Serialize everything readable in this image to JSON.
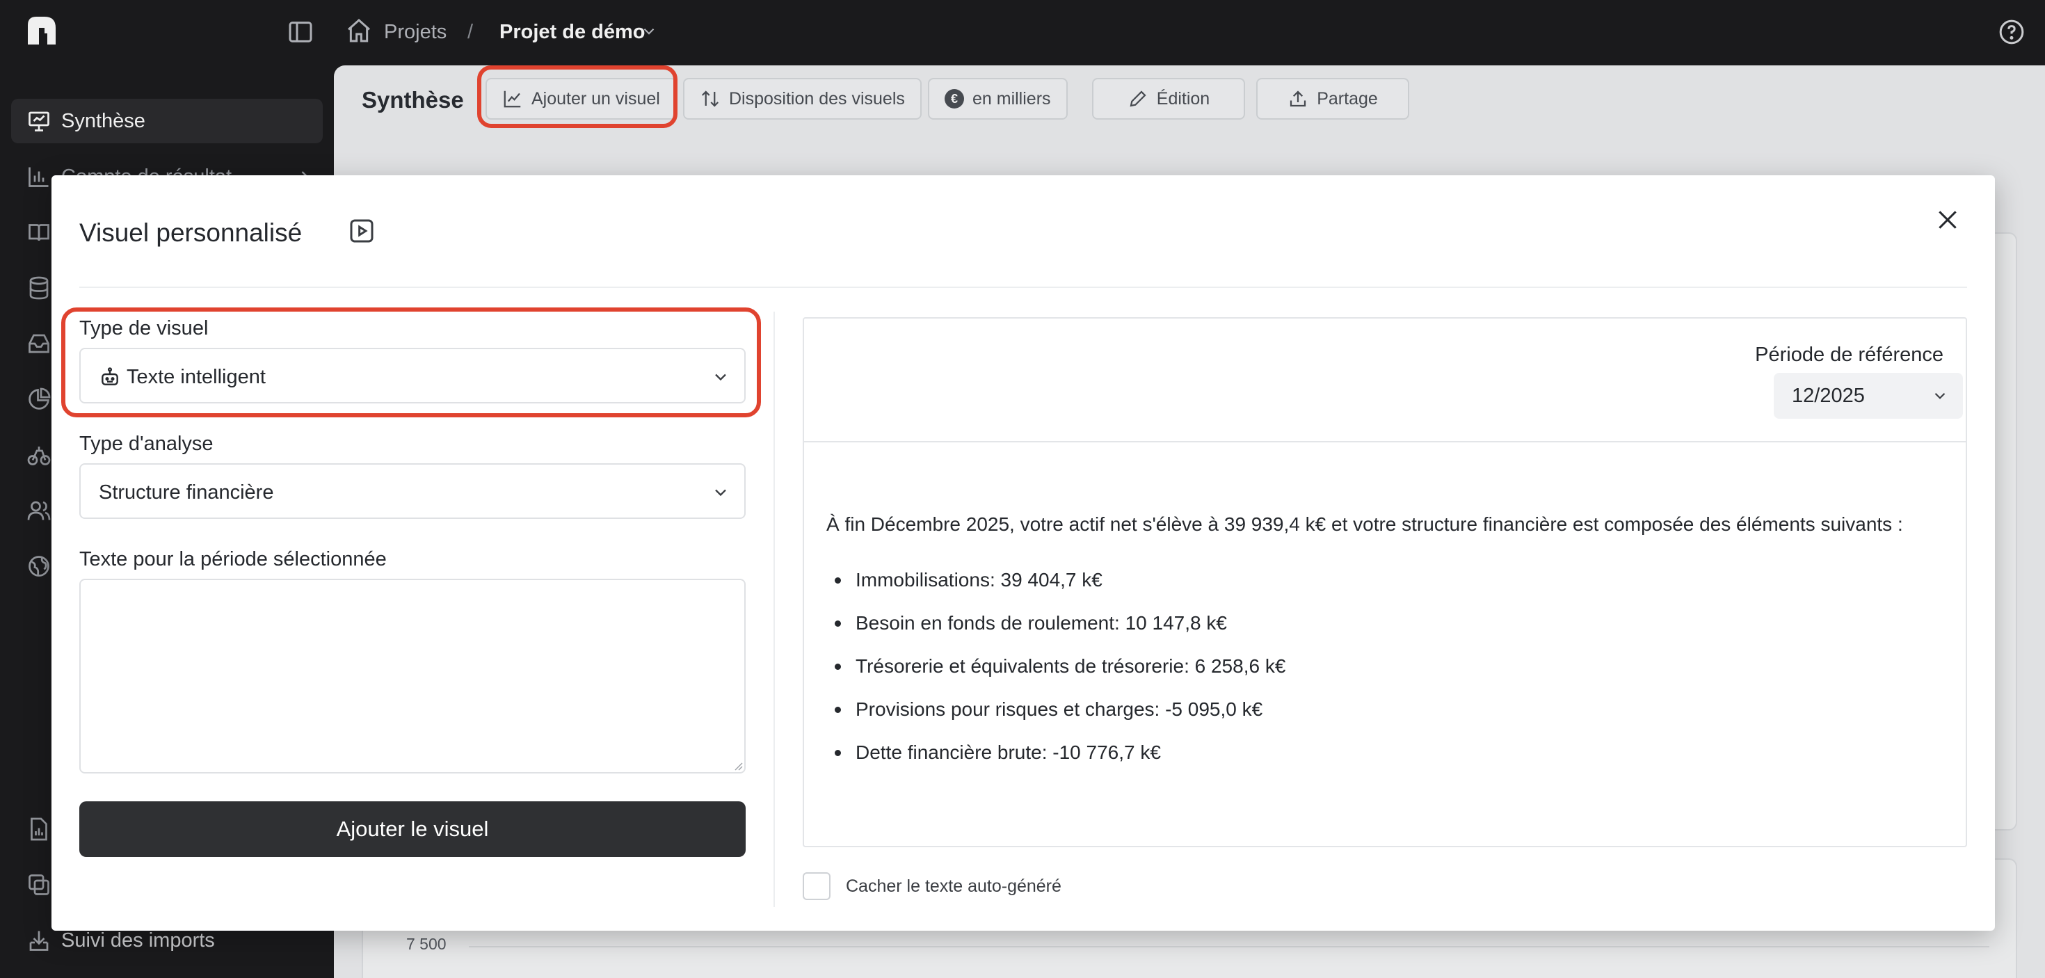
{
  "breadcrumb": {
    "projects": "Projets",
    "separator": "/",
    "current": "Projet de démo"
  },
  "sidebar": {
    "items": [
      {
        "label": "Synthèse",
        "icon": "presentation-icon",
        "active": true
      },
      {
        "label": "Compte de résultat",
        "icon": "bar-chart-icon"
      },
      {
        "label": "",
        "icon": "book-icon"
      },
      {
        "label": "",
        "icon": "database-icon"
      },
      {
        "label": "",
        "icon": "inbox-icon"
      },
      {
        "label": "",
        "icon": "pie-chart-icon"
      },
      {
        "label": "",
        "icon": "scale-icon"
      },
      {
        "label": "",
        "icon": "users-icon"
      },
      {
        "label": "",
        "icon": "globe-icon"
      }
    ],
    "bottom": [
      {
        "label": "",
        "icon": "file-chart-icon"
      },
      {
        "label": "",
        "icon": "copy-icon"
      },
      {
        "label": "Suivi des imports",
        "icon": "import-icon"
      }
    ]
  },
  "toolbar": {
    "title": "Synthèse",
    "add_visual": "Ajouter un visuel",
    "layout": "Disposition des visuels",
    "units": "en milliers",
    "currency_symbol": "€",
    "edit": "Édition",
    "share": "Partage"
  },
  "background": {
    "tick": "7 500"
  },
  "modal": {
    "title": "Visuel personnalisé",
    "visual_type_label": "Type de visuel",
    "visual_type_value": "Texte intelligent",
    "analysis_type_label": "Type d'analyse",
    "analysis_type_value": "Structure financière",
    "period_text_label": "Texte pour la période sélectionnée",
    "period_text_value": "",
    "submit": "Ajouter le visuel",
    "hide_autotext_label": "Cacher le texte auto-généré",
    "hide_autotext_checked": false
  },
  "preview": {
    "reference_label": "Période de référence",
    "reference_value": "12/2025",
    "summary": "À fin Décembre 2025, votre actif net s'élève à 39 939,4 k€ et votre structure financière est composée des éléments suivants :",
    "bullets": [
      "Immobilisations: 39 404,7 k€",
      "Besoin en fonds de roulement: 10 147,8 k€",
      "Trésorerie et équivalents de trésorerie: 6 258,6 k€",
      "Provisions pour risques et charges: -5 095,0 k€",
      "Dette financière brute: -10 776,7 k€"
    ]
  },
  "colors": {
    "highlight": "#e0432f",
    "sidebar_bg": "#1c1c1e",
    "primary_button": "#2f3033"
  }
}
